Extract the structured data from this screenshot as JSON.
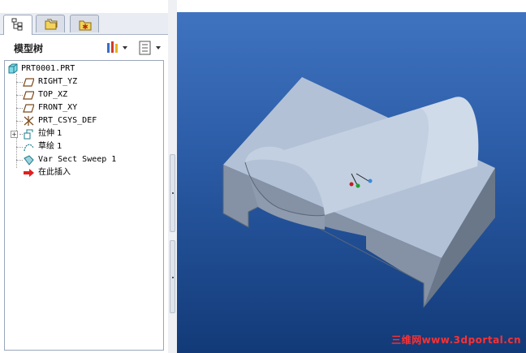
{
  "panel": {
    "title": "模型树",
    "tabs": [
      {
        "icon": "model-tree-icon",
        "active": true
      },
      {
        "icon": "folder-browser-icon",
        "active": false
      },
      {
        "icon": "favorites-icon",
        "active": false
      }
    ]
  },
  "tree": {
    "nodes": [
      {
        "label": "PRT0001.PRT",
        "icon": "part-icon"
      },
      {
        "label": "RIGHT_YZ",
        "icon": "datum-plane-icon"
      },
      {
        "label": "TOP_XZ",
        "icon": "datum-plane-icon"
      },
      {
        "label": "FRONT_XY",
        "icon": "datum-plane-icon"
      },
      {
        "label": "PRT_CSYS_DEF",
        "icon": "csys-icon"
      },
      {
        "label": "拉伸 1",
        "icon": "extrude-icon"
      },
      {
        "label": "草绘 1",
        "icon": "sketch-icon"
      },
      {
        "label": "Var Sect Sweep 1",
        "icon": "sweep-icon"
      },
      {
        "label": "在此插入",
        "icon": "insert-here-arrow-icon"
      }
    ]
  },
  "watermark": "三维网www.3dportal.cn",
  "colors": {
    "viewport_top": "#3f73c0",
    "viewport_bottom": "#123a78",
    "model_face_top": "#b8c6db",
    "model_face_side": "#6c7a8c",
    "model_face_front": "#8a98ab",
    "watermark": "#ff3030"
  }
}
